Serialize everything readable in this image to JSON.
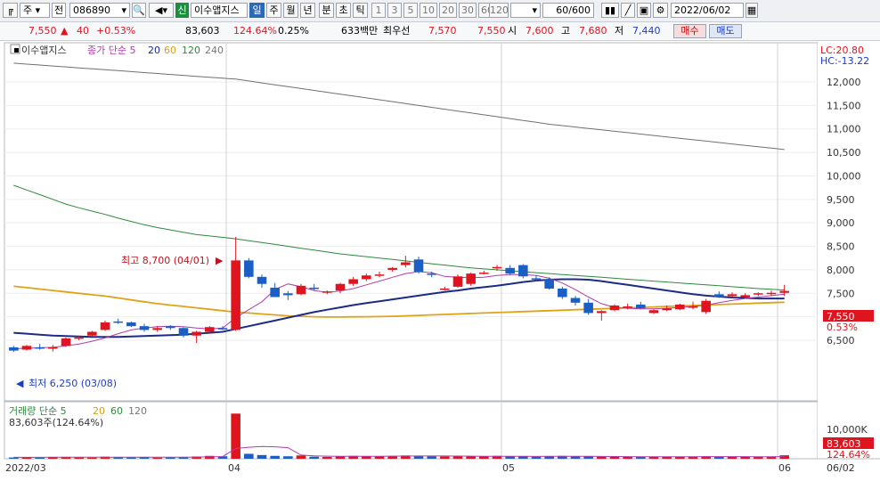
{
  "toolbar": {
    "period_prefix": "주",
    "scope": "전",
    "code": "086890",
    "credit": "신",
    "name": "이수앱지스",
    "periods": [
      "일",
      "주",
      "월",
      "년",
      "분",
      "초",
      "틱"
    ],
    "numbers": [
      "1",
      "3",
      "5",
      "10",
      "20",
      "30",
      "60",
      "120"
    ],
    "count": "60/600",
    "date": "2022/06/02"
  },
  "quote": {
    "price": "7,550",
    "change": "40",
    "change_pct": "+0.53%",
    "volume": "83,603",
    "vol_ratio": "124.64%",
    "turnover": "0.25%",
    "amount": "633백만",
    "bid_label": "최우선",
    "bid1": "7,570",
    "bid2": "7,550",
    "open_label": "시",
    "open": "7,600",
    "high_label": "고",
    "high": "7,680",
    "low_label": "저",
    "low": "7,440",
    "buy": "매수",
    "sell": "매도"
  },
  "legend": {
    "name": "이수앱지스",
    "ma_label": "종가 단순 5",
    "ma20": "20",
    "ma60": "60",
    "ma120": "120",
    "ma240": "240",
    "lc": "LC:20.80",
    "hc": "HC:-13.22"
  },
  "annotations": {
    "high": "최고 8,700 (04/01)",
    "low": "최저 6,250 (03/08)"
  },
  "price_axis": [
    "12,000",
    "11,500",
    "11,000",
    "10,500",
    "10,000",
    "9,500",
    "9,000",
    "8,500",
    "8,000",
    "7,500",
    "7,000",
    "6,500"
  ],
  "price_tag": "7,550",
  "pct_tag": "0.53%",
  "volume_legend": {
    "label": "거래량 단순 5",
    "ma20": "20",
    "ma60": "60",
    "ma120": "120",
    "value": "83,603주(124.64%)"
  },
  "volume_axis": "10,000K",
  "volume_tag": "83,603",
  "volume_pct_tag": "124.64%",
  "x_labels": [
    "2022/03",
    "04",
    "05",
    "06"
  ],
  "x_axis_right": "06/02",
  "chart_data": {
    "type": "candlestick",
    "price_range": [
      6200,
      12400
    ],
    "candles": [
      [
        6350,
        6380,
        6250,
        6280
      ],
      [
        6300,
        6400,
        6280,
        6380
      ],
      [
        6350,
        6420,
        6300,
        6320
      ],
      [
        6320,
        6400,
        6260,
        6350
      ],
      [
        6380,
        6560,
        6360,
        6540
      ],
      [
        6540,
        6600,
        6500,
        6560
      ],
      [
        6600,
        6700,
        6580,
        6680
      ],
      [
        6720,
        6920,
        6700,
        6880
      ],
      [
        6900,
        6960,
        6850,
        6880
      ],
      [
        6880,
        6900,
        6780,
        6800
      ],
      [
        6800,
        6850,
        6680,
        6720
      ],
      [
        6720,
        6800,
        6680,
        6760
      ],
      [
        6800,
        6820,
        6720,
        6760
      ],
      [
        6760,
        6780,
        6560,
        6600
      ],
      [
        6600,
        6700,
        6440,
        6680
      ],
      [
        6680,
        6800,
        6640,
        6780
      ],
      [
        6760,
        6800,
        6720,
        6730
      ],
      [
        6720,
        8700,
        6700,
        8200
      ],
      [
        8200,
        8250,
        7820,
        7850
      ],
      [
        7850,
        7900,
        7620,
        7700
      ],
      [
        7620,
        7720,
        7420,
        7420
      ],
      [
        7500,
        7550,
        7360,
        7460
      ],
      [
        7480,
        7700,
        7460,
        7660
      ],
      [
        7620,
        7700,
        7560,
        7600
      ],
      [
        7520,
        7560,
        7480,
        7540
      ],
      [
        7560,
        7720,
        7500,
        7700
      ],
      [
        7700,
        7850,
        7660,
        7800
      ],
      [
        7800,
        7920,
        7760,
        7880
      ],
      [
        7900,
        7960,
        7840,
        7900
      ],
      [
        8000,
        8060,
        7960,
        8040
      ],
      [
        8100,
        8300,
        8050,
        8160
      ],
      [
        8220,
        8280,
        7920,
        7960
      ],
      [
        7920,
        7960,
        7840,
        7900
      ],
      [
        7600,
        7640,
        7560,
        7600
      ],
      [
        7640,
        7900,
        7620,
        7860
      ],
      [
        7700,
        7940,
        7660,
        7920
      ],
      [
        7940,
        7980,
        7900,
        7940
      ],
      [
        8040,
        8100,
        7980,
        8060
      ],
      [
        8040,
        8100,
        7880,
        7920
      ],
      [
        8100,
        8120,
        7820,
        7860
      ],
      [
        7820,
        7880,
        7760,
        7800
      ],
      [
        7800,
        7840,
        7580,
        7600
      ],
      [
        7600,
        7640,
        7380,
        7420
      ],
      [
        7400,
        7440,
        7240,
        7300
      ],
      [
        7300,
        7380,
        7040,
        7080
      ],
      [
        7080,
        7140,
        6920,
        7120
      ],
      [
        7140,
        7260,
        7120,
        7240
      ],
      [
        7200,
        7280,
        7160,
        7220
      ],
      [
        7260,
        7320,
        7160,
        7180
      ],
      [
        7080,
        7160,
        7060,
        7140
      ],
      [
        7140,
        7240,
        7120,
        7180
      ],
      [
        7160,
        7280,
        7140,
        7260
      ],
      [
        7200,
        7320,
        7160,
        7220
      ],
      [
        7100,
        7380,
        7060,
        7340
      ],
      [
        7480,
        7540,
        7400,
        7420
      ],
      [
        7440,
        7520,
        7420,
        7480
      ],
      [
        7420,
        7500,
        7400,
        7460
      ],
      [
        7480,
        7520,
        7440,
        7500
      ],
      [
        7500,
        7560,
        7440,
        7510
      ],
      [
        7510,
        7680,
        7440,
        7550
      ]
    ],
    "ma5": [
      6320,
      6330,
      6340,
      6350,
      6380,
      6420,
      6480,
      6550,
      6640,
      6720,
      6760,
      6790,
      6800,
      6790,
      6760,
      6740,
      6760,
      6980,
      7150,
      7320,
      7580,
      7700,
      7640,
      7560,
      7520,
      7550,
      7600,
      7680,
      7760,
      7840,
      7920,
      7960,
      7940,
      7860,
      7840,
      7830,
      7840,
      7880,
      7900,
      7900,
      7880,
      7820,
      7720,
      7580,
      7420,
      7280,
      7200,
      7180,
      7170,
      7170,
      7180,
      7200,
      7220,
      7250,
      7300,
      7350,
      7390,
      7420,
      7450,
      7480
    ],
    "ma20": [
      6660,
      6640,
      6620,
      6600,
      6590,
      6580,
      6570,
      6570,
      6570,
      6580,
      6590,
      6600,
      6610,
      6620,
      6640,
      6660,
      6680,
      6740,
      6800,
      6860,
      6920,
      6980,
      7040,
      7100,
      7150,
      7200,
      7250,
      7290,
      7330,
      7370,
      7410,
      7450,
      7490,
      7530,
      7560,
      7600,
      7630,
      7660,
      7700,
      7740,
      7770,
      7790,
      7800,
      7800,
      7790,
      7760,
      7720,
      7680,
      7640,
      7600,
      7560,
      7520,
      7480,
      7450,
      7430,
      7410,
      7400,
      7390,
      7390,
      7390
    ],
    "ma60": [
      7650,
      7620,
      7590,
      7560,
      7530,
      7500,
      7470,
      7440,
      7400,
      7360,
      7320,
      7280,
      7250,
      7220,
      7190,
      7160,
      7130,
      7100,
      7080,
      7060,
      7040,
      7020,
      7010,
      7000,
      6995,
      6995,
      6998,
      7000,
      7005,
      7010,
      7020,
      7030,
      7040,
      7050,
      7060,
      7070,
      7080,
      7090,
      7100,
      7110,
      7120,
      7130,
      7140,
      7150,
      7160,
      7170,
      7180,
      7190,
      7200,
      7210,
      7220,
      7230,
      7240,
      7250,
      7260,
      7270,
      7280,
      7290,
      7300,
      7310
    ],
    "ma120": [
      9800,
      9700,
      9600,
      9500,
      9400,
      9320,
      9250,
      9180,
      9100,
      9030,
      8960,
      8900,
      8850,
      8800,
      8750,
      8720,
      8690,
      8660,
      8620,
      8580,
      8540,
      8500,
      8460,
      8420,
      8380,
      8340,
      8310,
      8280,
      8250,
      8220,
      8190,
      8160,
      8130,
      8100,
      8070,
      8040,
      8020,
      8000,
      7980,
      7960,
      7940,
      7920,
      7900,
      7880,
      7860,
      7840,
      7820,
      7800,
      7780,
      7760,
      7740,
      7720,
      7700,
      7680,
      7660,
      7640,
      7620,
      7600,
      7585,
      7570
    ],
    "ma240": [
      12400,
      12380,
      12360,
      12340,
      12320,
      12300,
      12280,
      12260,
      12240,
      12220,
      12200,
      12180,
      12160,
      12140,
      12120,
      12100,
      12080,
      12060,
      12020,
      11980,
      11940,
      11900,
      11860,
      11820,
      11780,
      11740,
      11700,
      11660,
      11620,
      11580,
      11540,
      11500,
      11460,
      11420,
      11380,
      11340,
      11300,
      11260,
      11220,
      11180,
      11140,
      11100,
      11070,
      11040,
      11010,
      10980,
      10950,
      10920,
      10890,
      10860,
      10830,
      10800,
      10770,
      10740,
      10710,
      10680,
      10650,
      10620,
      10590,
      10560
    ],
    "volume": [
      30,
      40,
      25,
      35,
      45,
      30,
      28,
      50,
      32,
      30,
      35,
      28,
      30,
      40,
      55,
      70,
      60,
      1100,
      120,
      90,
      70,
      60,
      80,
      50,
      45,
      60,
      70,
      65,
      55,
      70,
      80,
      75,
      60,
      55,
      65,
      60,
      55,
      70,
      60,
      55,
      50,
      60,
      70,
      65,
      55,
      50,
      45,
      50,
      48,
      45,
      50,
      52,
      55,
      60,
      50,
      45,
      48,
      50,
      52,
      84
    ],
    "volume_ma5": [
      35,
      35,
      35,
      36,
      36,
      36,
      36,
      38,
      38,
      38,
      38,
      38,
      38,
      38,
      42,
      48,
      52,
      250,
      280,
      300,
      290,
      270,
      90,
      70,
      62,
      60,
      58,
      58,
      60,
      62,
      66,
      68,
      68,
      68,
      66,
      64,
      60,
      60,
      60,
      58,
      56,
      58,
      60,
      60,
      58,
      56,
      54,
      52,
      50,
      48,
      48,
      49,
      50,
      52,
      53,
      52,
      51,
      50,
      50,
      55
    ]
  }
}
